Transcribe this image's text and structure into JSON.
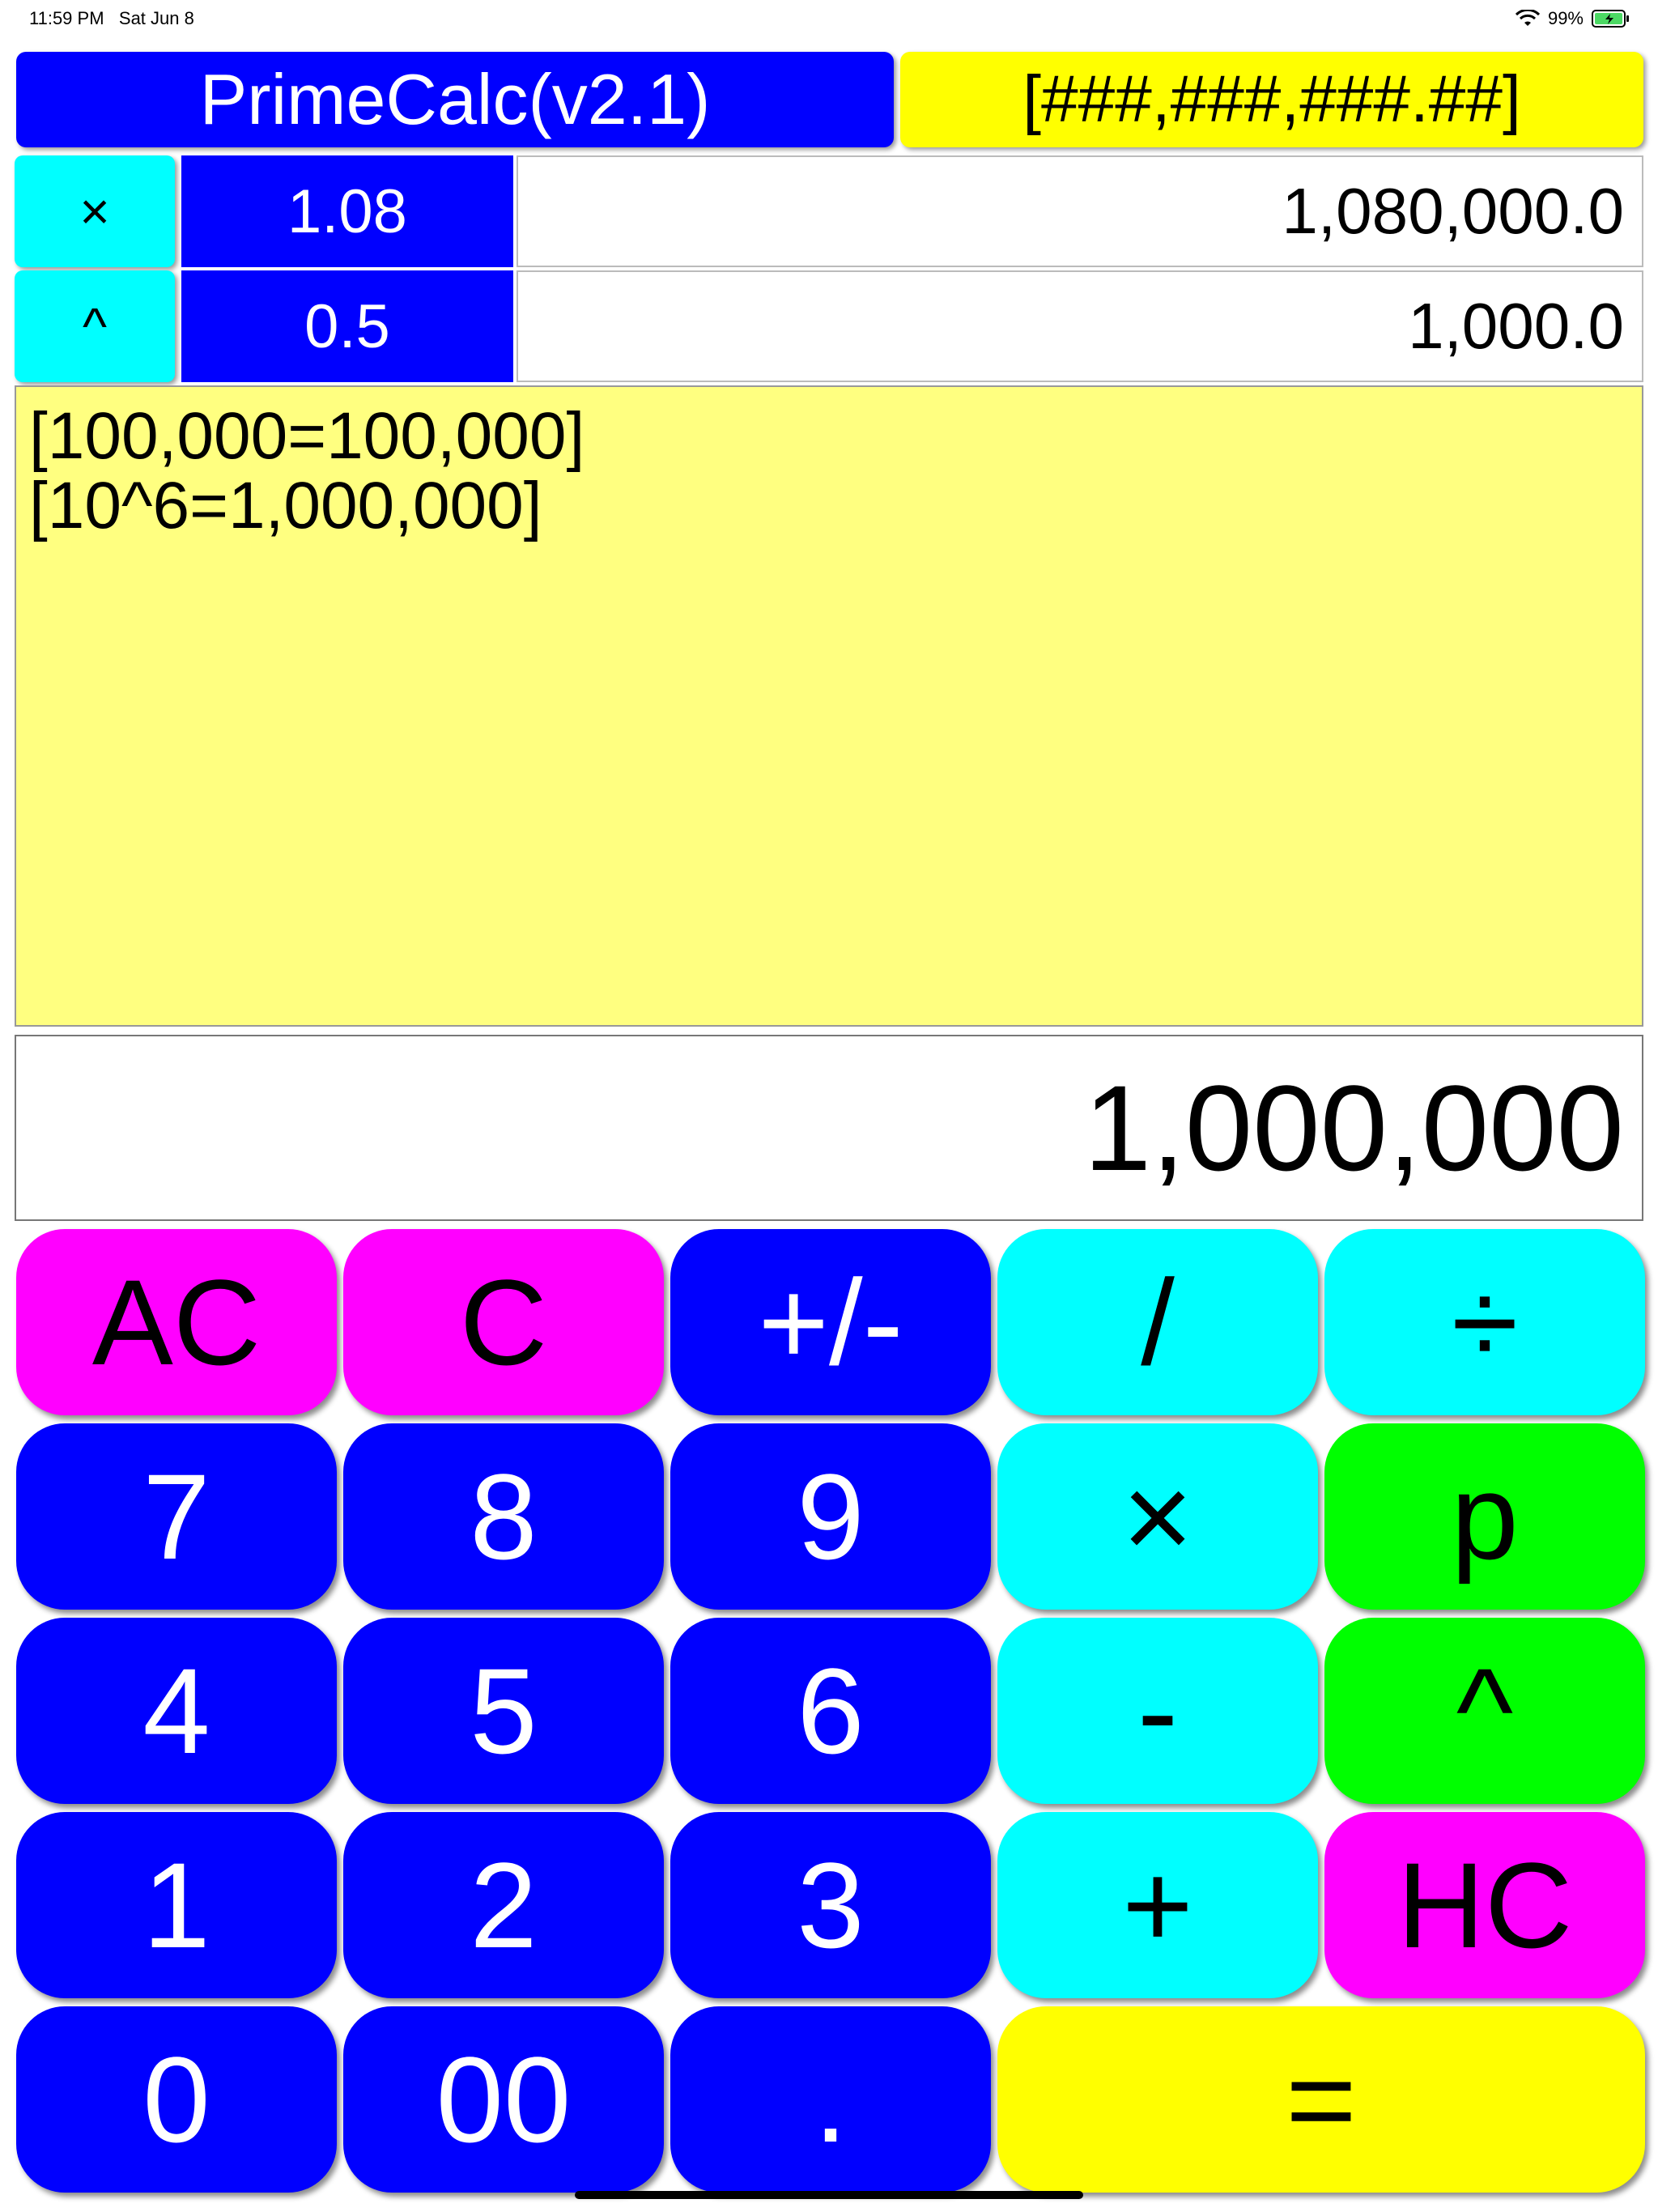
{
  "status_bar": {
    "time": "11:59 PM",
    "date": "Sat Jun 8",
    "battery": "99%"
  },
  "header": {
    "title": "PrimeCalc(v2.1)",
    "format": "[###,###,###.##]"
  },
  "memory_rows": [
    {
      "op": "×",
      "factor": "1.08",
      "result": "1,080,000.0"
    },
    {
      "op": "^",
      "factor": "0.5",
      "result": "1,000.0"
    }
  ],
  "history": [
    "[100,000=100,000]",
    "[10^6=1,000,000]"
  ],
  "display": "1,000,000",
  "keys": {
    "ac": "AC",
    "c": "C",
    "sign": "+/-",
    "slash": "/",
    "divide": "÷",
    "seven": "7",
    "eight": "8",
    "nine": "9",
    "multiply": "×",
    "prime": "p",
    "four": "4",
    "five": "5",
    "six": "6",
    "minus": "-",
    "power": "^",
    "one": "1",
    "two": "2",
    "three": "3",
    "plus": "+",
    "hc": "HC",
    "zero": "0",
    "double_zero": "00",
    "decimal": ".",
    "equals": "="
  },
  "colors": {
    "blue": "#0000ff",
    "magenta": "#ff00ff",
    "cyan": "#00ffff",
    "green": "#00ff00",
    "yellow": "#ffff00",
    "tape": "#ffff80"
  }
}
